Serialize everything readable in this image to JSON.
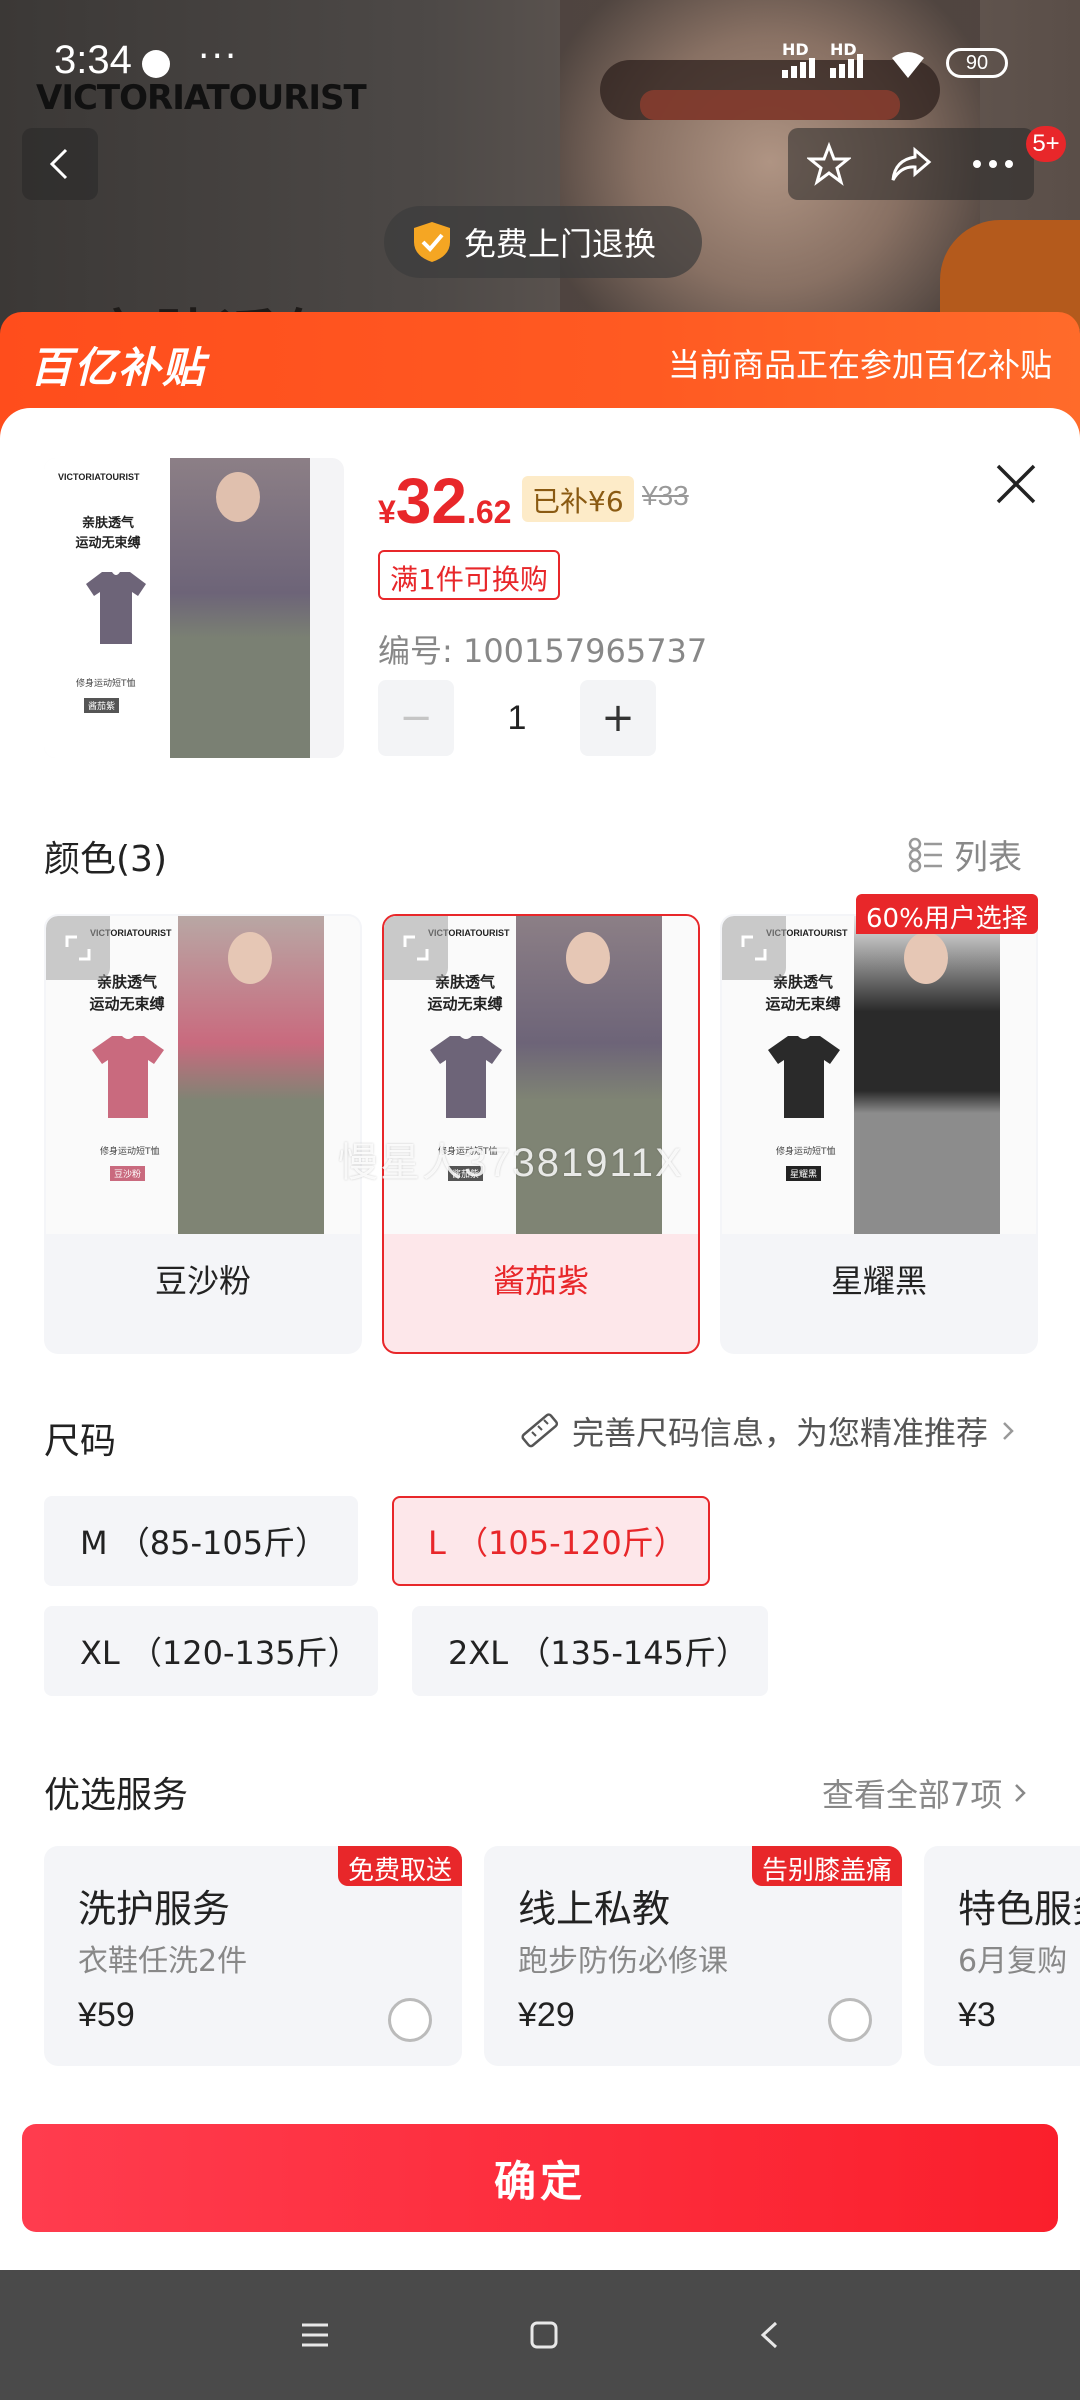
{
  "status_bar": {
    "time": "3:34",
    "more": "···",
    "battery": "90",
    "signal1": "HD",
    "signal2": "HD",
    "brand": "VICTORIATOURIST"
  },
  "header": {
    "badge_count": "5+",
    "return_pill": "免费上门退换",
    "bg_headline": "亲肤透气"
  },
  "subsidy_banner": {
    "logo": "百亿补贴",
    "message": "当前商品正在参加百亿补贴"
  },
  "product": {
    "price_currency": "¥",
    "price_int": "32",
    "price_dec": ".62",
    "subsidy_tag": "已补¥6",
    "original_price": "¥33",
    "exchange_tag": "满1件可换购",
    "sku_number": "编号: 100157965737",
    "quantity": "1",
    "minus": "−",
    "plus": "+",
    "thumb_brand": "VICTORIATOURIST",
    "thumb_line1": "亲肤透气",
    "thumb_line2": "运动无束缚",
    "thumb_caption": "修身运动短T恤",
    "thumb_tag": "酱茄紫"
  },
  "color": {
    "title": "颜色(3)",
    "list_toggle": "列表",
    "popular_badge": "60%用户选择",
    "options": [
      {
        "label": "豆沙粉",
        "selected": false,
        "shirt_color": "#c96a7e",
        "tag": "豆沙粉"
      },
      {
        "label": "酱茄紫",
        "selected": true,
        "shirt_color": "#6d6478",
        "tag": "酱茄紫"
      },
      {
        "label": "星耀黑",
        "selected": false,
        "shirt_color": "#2a2a2a",
        "tag": "星耀黑"
      }
    ],
    "mini_brand": "VICTORIATOURIST",
    "mini_line1": "亲肤透气",
    "mini_line2": "运动无束缚",
    "mini_caption": "修身运动短T恤"
  },
  "watermark": "慢星人37381911X",
  "size": {
    "title": "尺码",
    "hint": "完善尺码信息，为您精准推荐",
    "options": [
      {
        "label": "M （85-105斤）",
        "selected": false
      },
      {
        "label": "L （105-120斤）",
        "selected": true
      },
      {
        "label": "XL （120-135斤）",
        "selected": false
      },
      {
        "label": "2XL （135-145斤）",
        "selected": false
      }
    ]
  },
  "services": {
    "title": "优选服务",
    "view_all": "查看全部7项",
    "items": [
      {
        "name": "洗护服务",
        "desc": "衣鞋任洗2件",
        "price": "¥59",
        "tag": "免费取送"
      },
      {
        "name": "线上私教",
        "desc": "跑步防伤必修课",
        "price": "¥29",
        "tag": "告别膝盖痛"
      },
      {
        "name": "特色服务",
        "desc": "6月复购",
        "price": "¥3",
        "tag": ""
      }
    ]
  },
  "confirm_button": "确定",
  "colors": {
    "accent": "#e8272a",
    "subsidy_orange": "#ff5a22",
    "chip_bg": "#f4f5f8"
  }
}
